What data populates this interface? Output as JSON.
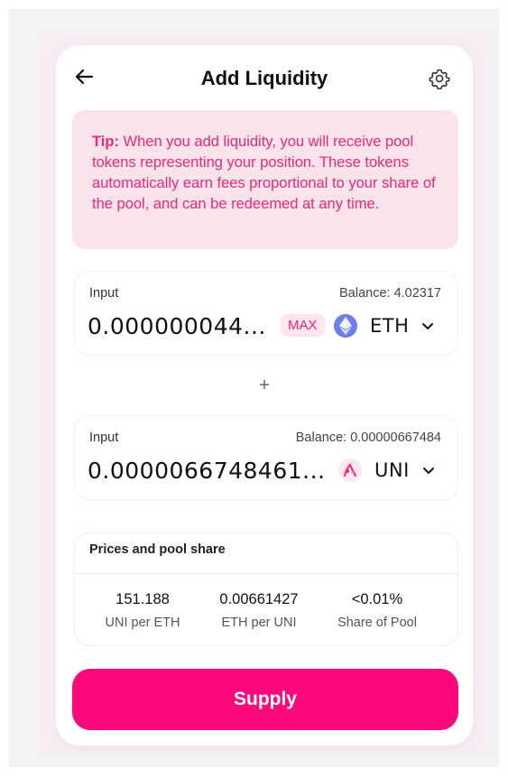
{
  "header": {
    "title": "Add Liquidity",
    "back_icon": "arrow-left-icon",
    "settings_icon": "gear-icon"
  },
  "tip": {
    "prefix": "Tip:",
    "text": " When you add liquidity, you will receive pool tokens representing your position. These tokens automatically earn fees proportional to your share of the pool, and can be redeemed at any time."
  },
  "input_a": {
    "label": "Input",
    "balance": "Balance: 4.02317",
    "amount": "0.000000044...",
    "max_label": "MAX",
    "token": "ETH",
    "token_icon": "ethereum-icon"
  },
  "plus": "+",
  "input_b": {
    "label": "Input",
    "balance": "Balance: 0.00000667484",
    "amount": "0.0000066748461...",
    "token": "UNI",
    "token_icon": "uniswap-icon"
  },
  "prices": {
    "title": "Prices and pool share",
    "stats": [
      {
        "value": "151.188",
        "label": "UNI per ETH"
      },
      {
        "value": "0.00661427",
        "label": "ETH per UNI"
      },
      {
        "value": "<0.01%",
        "label": "Share of Pool"
      }
    ]
  },
  "supply_label": "Supply",
  "colors": {
    "accent": "#fc0a7b",
    "tip_bg": "#fbe3ec",
    "tip_text": "#ee2779",
    "eth": "#6b7fe6"
  }
}
